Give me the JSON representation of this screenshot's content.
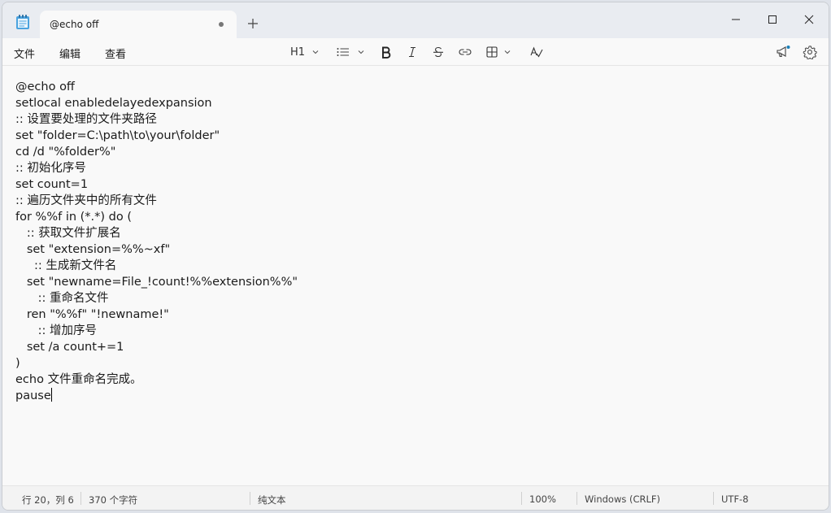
{
  "tab": {
    "title": "@echo off"
  },
  "menu": {
    "file": "文件",
    "edit": "编辑",
    "view": "查看"
  },
  "toolbar": {
    "heading": "H1"
  },
  "editor": {
    "lines": [
      "@echo off",
      "setlocal enabledelayedexpansion",
      ":: 设置要处理的文件夹路径",
      "set \"folder=C:\\path\\to\\your\\folder\"",
      "cd /d \"%folder%\"",
      ":: 初始化序号",
      "set count=1",
      ":: 遍历文件夹中的所有文件",
      "for %%f in (*.*) do (",
      "   :: 获取文件扩展名",
      "   set \"extension=%%~xf\"",
      "     :: 生成新文件名",
      "   set \"newname=File_!count!%%extension%%\"",
      "      :: 重命名文件",
      "   ren \"%%f\" \"!newname!\"",
      "      :: 增加序号",
      "   set /a count+=1",
      ")",
      "echo 文件重命名完成。",
      "pause"
    ]
  },
  "status": {
    "position": "行 20，列 6",
    "chars": "370 个字符",
    "format": "纯文本",
    "zoom": "100%",
    "line_ending": "Windows (CRLF)",
    "encoding": "UTF-8"
  }
}
